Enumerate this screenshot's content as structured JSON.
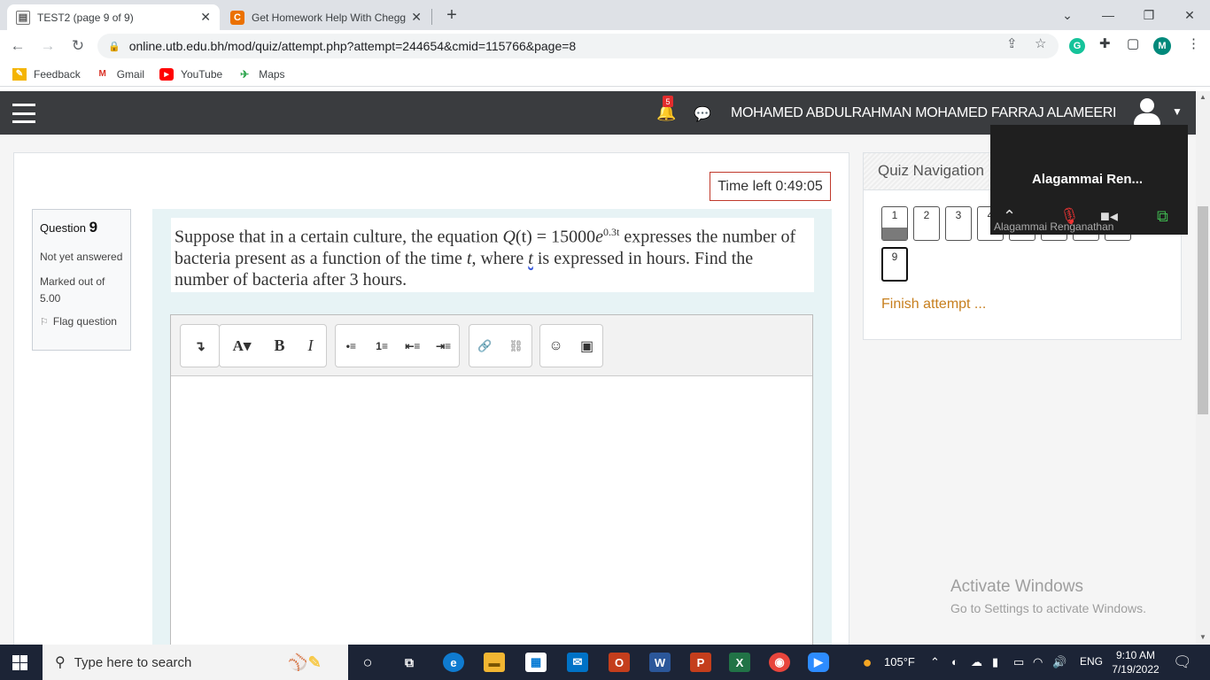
{
  "browser": {
    "tabs": [
      {
        "title": "TEST2 (page 9 of 9)",
        "close": "✕"
      },
      {
        "title": "Get Homework Help With Chegg",
        "close": "✕"
      }
    ],
    "new_tab": "+",
    "url": "online.utb.edu.bh/mod/quiz/attempt.php?attempt=244654&cmid=115766&page=8",
    "bookmarks": [
      "Feedback",
      "Gmail",
      "YouTube",
      "Maps"
    ],
    "extension_avatar": "M",
    "grammarly": "G"
  },
  "navbar": {
    "notification_count": "5",
    "user_name": "MOHAMED ABDULRAHMAN MOHAMED FARRAJ ALAMEERI"
  },
  "quiz": {
    "time_left": "Time left 0:49:05",
    "question": {
      "label": "Question",
      "number": "9",
      "state": "Not yet answered",
      "marks": "Marked out of 5.00",
      "flag": "Flag question",
      "text_prefix": "Suppose that in a certain culture, the equation ",
      "eq_q": "Q",
      "eq_t": "(t)",
      "eq_mid": " = 15000",
      "eq_e": "e",
      "eq_exp": "0.3t",
      "text_suffix": " expresses the number of bacteria present as a function of the time ",
      "t1": "t",
      "text_mid": ", where ",
      "t2": "t",
      "text_end": " is expressed in hours. Find the number of bacteria after 3 hours."
    },
    "editor": {
      "tools": [
        "↴",
        "A▾",
        "B",
        "I",
        "•≡",
        "1≡",
        "⇤≡",
        "⇥≡",
        "🔗",
        "⛓",
        "☺",
        "▣"
      ]
    },
    "navigation": {
      "title": "Quiz Navigation",
      "buttons": [
        "1",
        "2",
        "3",
        "4",
        "9"
      ],
      "finish": "Finish attempt ..."
    }
  },
  "zoom": {
    "name": "Alagammai Ren...",
    "subtitle": "Alagammai Renganathan"
  },
  "watermark": {
    "line1": "Activate Windows",
    "line2": "Go to Settings to activate Windows."
  },
  "taskbar": {
    "search_placeholder": "Type here to search",
    "weather": "105°F",
    "language": "ENG",
    "time": "9:10 AM",
    "date": "7/19/2022"
  }
}
